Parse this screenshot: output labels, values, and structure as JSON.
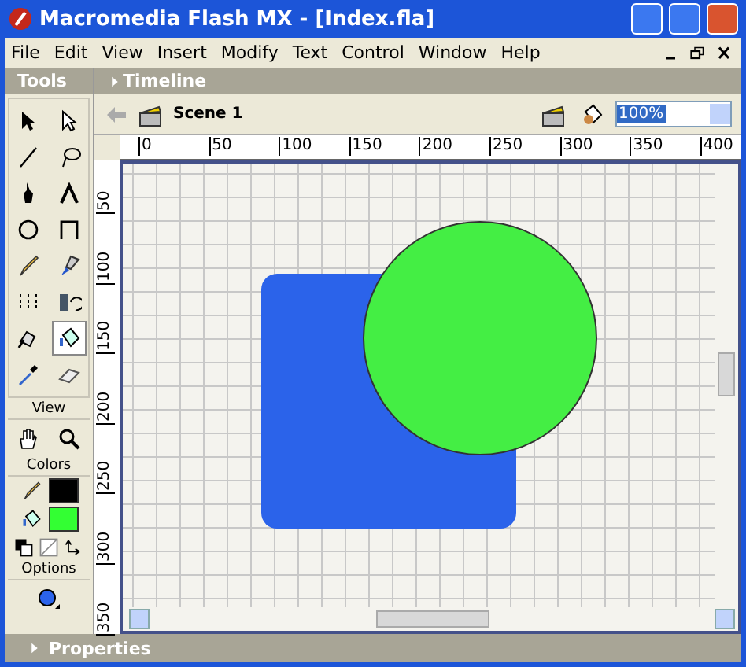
{
  "window": {
    "title": "Macromedia Flash MX - [Index.fla]"
  },
  "menu": [
    "File",
    "Edit",
    "View",
    "Insert",
    "Modify",
    "Text",
    "Control",
    "Window",
    "Help"
  ],
  "tools_panel": {
    "title": "Tools",
    "tools": [
      {
        "kind": "arrow",
        "selected": false
      },
      {
        "kind": "subselect",
        "selected": false
      },
      {
        "kind": "line",
        "selected": false
      },
      {
        "kind": "lasso",
        "selected": false
      },
      {
        "kind": "pen",
        "selected": false
      },
      {
        "kind": "text",
        "selected": false
      },
      {
        "kind": "oval",
        "selected": false
      },
      {
        "kind": "rectangle",
        "selected": false
      },
      {
        "kind": "pencil",
        "selected": false
      },
      {
        "kind": "brush",
        "selected": false
      },
      {
        "kind": "transform",
        "selected": false
      },
      {
        "kind": "fill-transform",
        "selected": false
      },
      {
        "kind": "ink",
        "selected": false
      },
      {
        "kind": "bucket",
        "selected": true
      },
      {
        "kind": "dropper",
        "selected": false
      },
      {
        "kind": "eraser",
        "selected": false
      }
    ]
  },
  "view_section": {
    "title": "View",
    "tools": [
      {
        "kind": "hand"
      },
      {
        "kind": "zoom"
      }
    ]
  },
  "colors_section": {
    "title": "Colors",
    "swatches": [
      {
        "kind": "stroke",
        "color": "#000000"
      },
      {
        "kind": "fill",
        "color": "#33ff33"
      }
    ]
  },
  "options_section": {
    "title": "Options"
  },
  "timeline": {
    "title": "Timeline"
  },
  "edit_bar": {
    "scene": "Scene 1",
    "zoom": "100%"
  },
  "ruler": {
    "x_ticks": [
      "0",
      "50",
      "100",
      "150",
      "200",
      "250",
      "300",
      "350",
      "400"
    ],
    "y_ticks": [
      "50",
      "100",
      "150",
      "200",
      "250",
      "300",
      "350"
    ]
  },
  "stage": {
    "shapes": [
      {
        "kind": "rounded-rect",
        "color": "#2b63ea"
      },
      {
        "kind": "circle",
        "color": "#44ee44"
      }
    ]
  },
  "properties": {
    "title": "Properties"
  }
}
